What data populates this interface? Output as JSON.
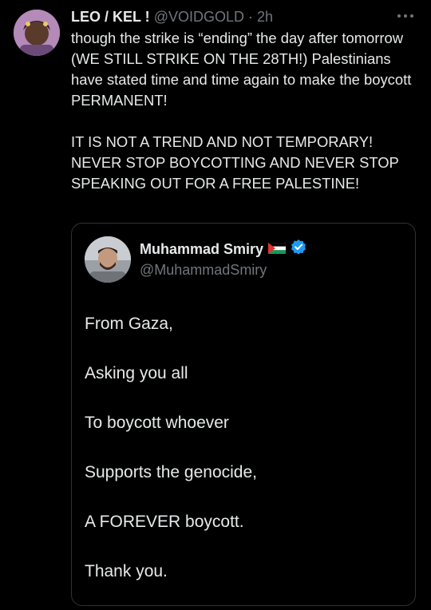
{
  "post": {
    "display_name": "LEO / KEL !",
    "handle": "@VOIDGOLD",
    "separator": "·",
    "time": "2h",
    "paragraphs": [
      "though the strike is “ending” the day after tomorrow (WE STILL STRIKE ON THE 28TH!) Palestinians have stated time and time again to make the boycott PERMANENT!",
      "IT IS NOT A TREND AND NOT TEMPORARY! NEVER STOP BOYCOTTING AND NEVER STOP SPEAKING OUT FOR A FREE PALESTINE!"
    ]
  },
  "quote": {
    "display_name": "Muhammad Smiry",
    "handle": "@MuhammadSmiry",
    "lines": [
      "From Gaza,",
      "Asking you all",
      "To boycott whoever",
      "Supports the genocide,",
      "A FOREVER boycott.",
      "Thank you."
    ]
  },
  "colors": {
    "background": "#000000",
    "text": "#e7e9ea",
    "muted": "#71767b",
    "border": "#2f3336",
    "verified": "#1d9bf0"
  },
  "icons": {
    "more": "more-dots-icon",
    "flag": "palestine-flag-icon",
    "verified": "verified-badge-icon"
  }
}
